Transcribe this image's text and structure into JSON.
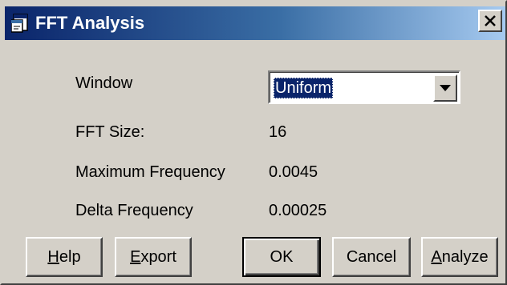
{
  "window": {
    "title": "FFT Analysis",
    "close_glyph": "✕"
  },
  "fields": {
    "window_label": "Window",
    "window_value": "Uniform",
    "fft_size_label": "FFT Size:",
    "fft_size_value": "16",
    "max_freq_label": "Maximum Frequency",
    "max_freq_value": "0.0045",
    "delta_freq_label": "Delta Frequency",
    "delta_freq_value": "0.00025"
  },
  "buttons": {
    "help": {
      "mnemonic": "H",
      "rest": "elp"
    },
    "export": {
      "mnemonic": "E",
      "rest": "xport"
    },
    "ok": "OK",
    "cancel": "Cancel",
    "analyze": {
      "mnemonic": "A",
      "rest": "nalyze"
    }
  },
  "icons": {
    "title": "app-window-icon",
    "close": "close-icon",
    "dropdown": "chevron-down-icon"
  },
  "colors": {
    "dialog_bg": "#d4d0c8",
    "title_gradient_start": "#0a246a",
    "title_gradient_end": "#a6caf0",
    "selection_bg": "#0a246a"
  }
}
